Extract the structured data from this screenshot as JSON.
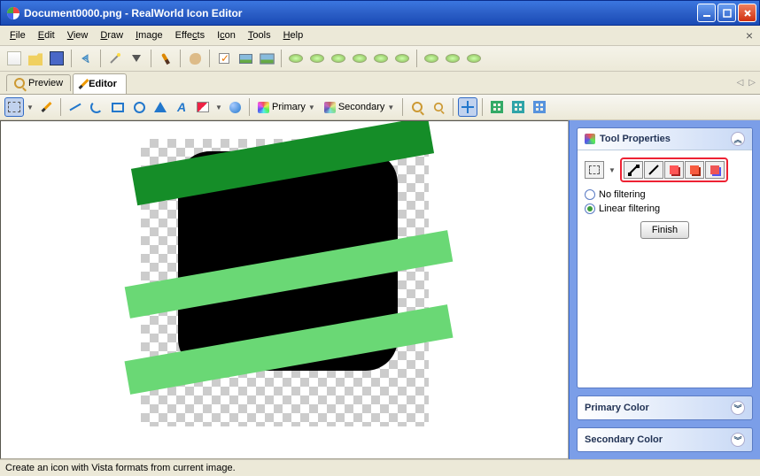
{
  "titlebar": {
    "text": "Document0000.png - RealWorld Icon Editor"
  },
  "menu": {
    "file": "File",
    "edit": "Edit",
    "view": "View",
    "draw": "Draw",
    "image": "Image",
    "effects": "Effects",
    "icon": "Icon",
    "tools": "Tools",
    "help": "Help"
  },
  "tabs": {
    "preview": "Preview",
    "editor": "Editor"
  },
  "toolsbar": {
    "primary": "Primary",
    "secondary": "Secondary"
  },
  "panel": {
    "tool_properties": "Tool Properties",
    "no_filtering": "No filtering",
    "linear_filtering": "Linear filtering",
    "finish": "Finish",
    "primary_color": "Primary Color",
    "secondary_color": "Secondary Color"
  },
  "statusbar": {
    "text": "Create an icon with Vista formats from current image."
  }
}
